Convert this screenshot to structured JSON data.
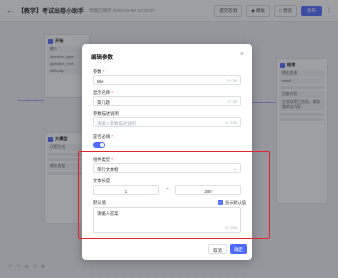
{
  "topbar": {
    "back_icon": "back-arrow-icon",
    "title": "【教学】考试出卷小助手",
    "saved_text": "草稿已保存 2025-01-08 18:24:07",
    "buttons": [
      "提交检测",
      "◆ 模板",
      "□ 预览"
    ],
    "primary_button": "发布",
    "more": "⋮"
  },
  "bg_nodes": {
    "left_title": "开始",
    "left_fields": [
      "输入",
      "question_type",
      "question_num",
      "difficulty"
    ],
    "left_title_2": "大模型",
    "left_fields_2": [
      "试题生成",
      "输出变量"
    ],
    "right_title": "结束",
    "right_fields": [
      "输出变量",
      "result",
      "回复内容"
    ],
    "right_text": "生成结果已完成，请查看输出内容",
    "bottom_tools": [
      "↶",
      "↷",
      "⊕",
      "⊖",
      "✥"
    ]
  },
  "dialog": {
    "title": "编辑参数",
    "close": "×",
    "param_name_label": "参数",
    "param_name_value": "title",
    "param_name_count": "5 / 30",
    "display_name_label": "显示名称",
    "display_name_value": "第几题",
    "display_name_count": "3 / 30",
    "desc_label": "参数描述说明",
    "desc_placeholder": "请输入参数描述说明",
    "desc_count": "0 / 100",
    "required_label": "是否必填",
    "required_on": true,
    "component_label": "组件类型",
    "component_value": "单行文本框",
    "length_label": "文本长度",
    "length_min": "1",
    "length_separator": "~",
    "length_max": "200",
    "default_label": "默认值",
    "show_default_label": "显示默认值",
    "default_value": "请输入答案",
    "default_count": "5 / 200",
    "cancel": "取消",
    "confirm": "确定"
  }
}
